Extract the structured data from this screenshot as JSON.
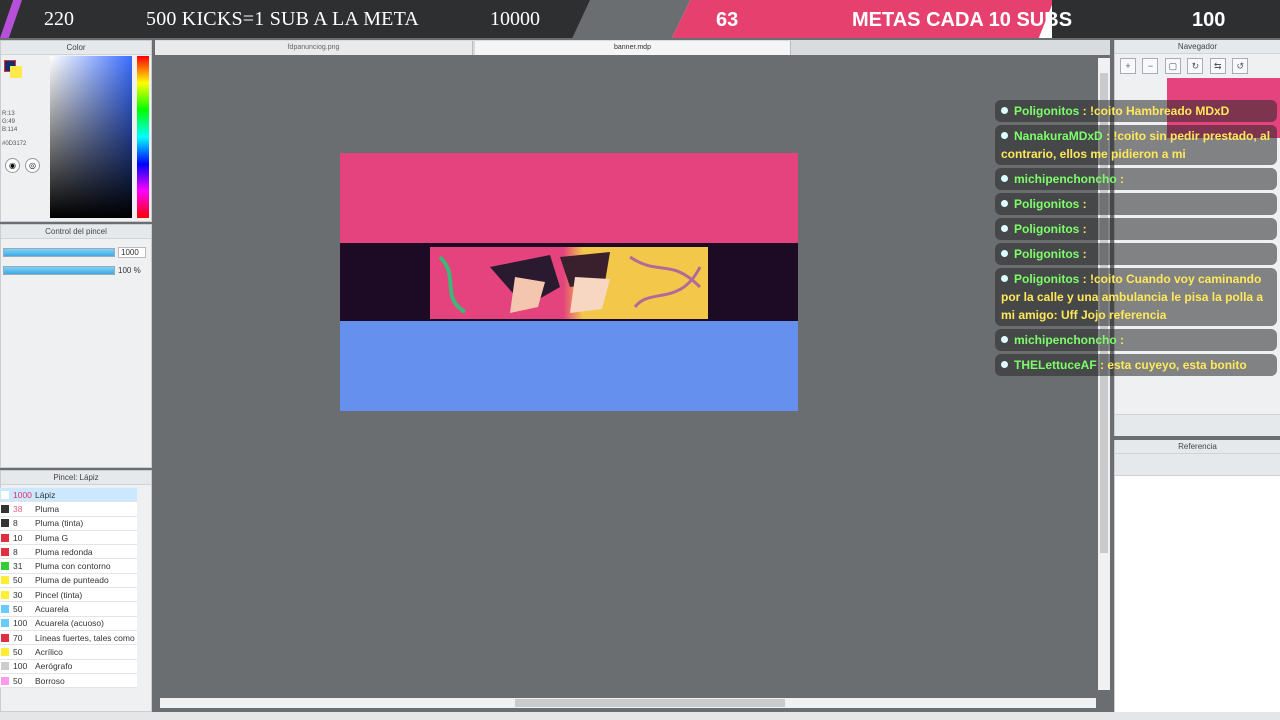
{
  "overlay": {
    "left_count": "220",
    "left_title": "500 KICKS=1 SUB A LA META",
    "left_goal": "10000",
    "right_count": "63",
    "right_title": "METAS CADA 10 SUBS",
    "right_goal": "100"
  },
  "color_panel": {
    "title": "Color",
    "rgb": [
      "R:13",
      "G:49",
      "B:114"
    ],
    "hex": "#0D3172"
  },
  "brush_control": {
    "title": "Control del pincel",
    "size": "1000",
    "opacity": "100 %"
  },
  "brush_panel": {
    "title": "Pincel: Lápiz",
    "brushes": [
      {
        "size": "1000",
        "name": "Lápiz",
        "color": "#ffffff"
      },
      {
        "size": "38",
        "name": "Pluma",
        "color": "#333333"
      },
      {
        "size": "8",
        "name": "Pluma (tinta)",
        "color": "#333333"
      },
      {
        "size": "10",
        "name": "Pluma G",
        "color": "#e03040"
      },
      {
        "size": "8",
        "name": "Pluma redonda",
        "color": "#e03040"
      },
      {
        "size": "31",
        "name": "Pluma con contorno",
        "color": "#33cc33"
      },
      {
        "size": "50",
        "name": "Pluma de punteado",
        "color": "#ffee33"
      },
      {
        "size": "30",
        "name": "Pincel (tinta)",
        "color": "#ffee33"
      },
      {
        "size": "50",
        "name": "Acuarela",
        "color": "#66ccff"
      },
      {
        "size": "100",
        "name": "Acuarela (acuoso)",
        "color": "#66ccff"
      },
      {
        "size": "70",
        "name": "Líneas fuertes, tales como",
        "color": "#e03040"
      },
      {
        "size": "50",
        "name": "Acrílico",
        "color": "#ffee33"
      },
      {
        "size": "100",
        "name": "Aerógrafo",
        "color": "#cccccc"
      },
      {
        "size": "50",
        "name": "Borroso",
        "color": "#ff99ee"
      }
    ]
  },
  "tabs": [
    "fdpanunciog.png",
    "banner.mdp"
  ],
  "right_panels": {
    "navigator": "Navegador",
    "reference": "Referencia"
  },
  "chat": [
    {
      "user": "Poligonitos",
      "text": " : !coito Hambreado MDxD"
    },
    {
      "user": "NanakuraMDxD",
      "text": " : !coito sin pedir prestado, al contrario, ellos me pidieron a mi"
    },
    {
      "user": "michipenchoncho",
      "text": " :"
    },
    {
      "user": "Poligonitos",
      "text": " :"
    },
    {
      "user": "Poligonitos",
      "text": " :"
    },
    {
      "user": "Poligonitos",
      "text": " :"
    },
    {
      "user": "Poligonitos",
      "text": " : !coito Cuando voy caminando por la calle y una ambulancia le pisa la polla a mi amigo: Uff Jojo referencia"
    },
    {
      "user": "michipenchoncho",
      "text": " :"
    },
    {
      "user": "THELettuceAF",
      "text": " : esta cuyeyo, esta bonito"
    }
  ]
}
